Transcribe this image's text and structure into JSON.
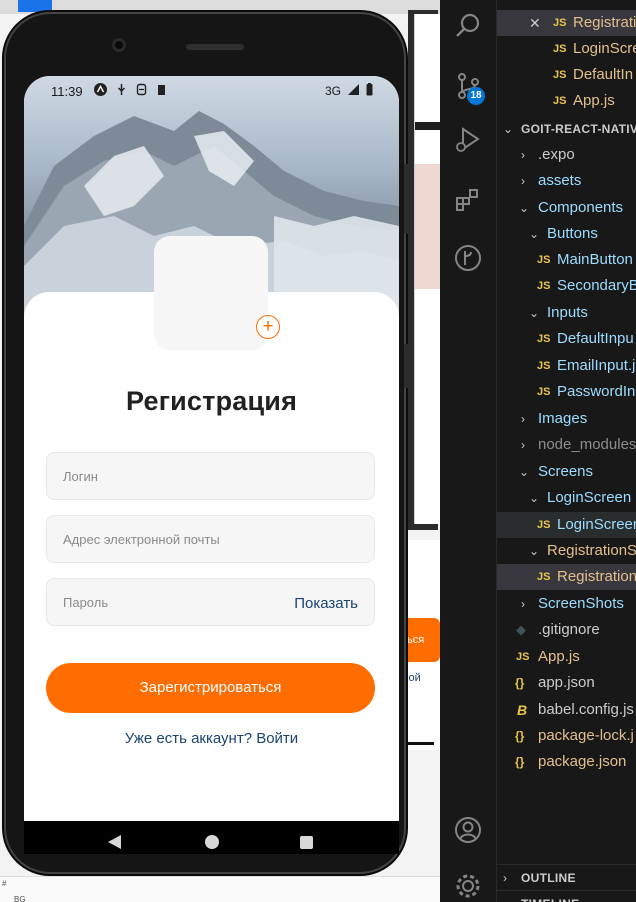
{
  "phone": {
    "status_time": "11:39",
    "status_network": "3G",
    "title": "Регистрация",
    "login_placeholder": "Логин",
    "email_placeholder": "Адрес электронной почты",
    "password_placeholder": "Пароль",
    "show_password_label": "Показать",
    "submit_label": "Зарегистрироваться",
    "login_link": "Уже есть аккаунт? Войти",
    "avatar_add_glyph": "+"
  },
  "background": {
    "button_fragment": "ться",
    "link_fragment": "? Вой",
    "bottom_hash": "#",
    "bottom_item": "BG"
  },
  "vscode": {
    "scm_badge": "18",
    "open_editors": [
      {
        "icon": "JS",
        "name": "Registrati",
        "close": "✕"
      },
      {
        "icon": "JS",
        "name": "LoginScre"
      },
      {
        "icon": "JS",
        "name": "DefaultIn"
      },
      {
        "icon": "JS",
        "name": "App.js"
      }
    ],
    "project_title": "GOIT-REACT-NATIV",
    "tree": [
      {
        "label": ".expo",
        "chev": "›"
      },
      {
        "label": "assets",
        "chev": "›"
      },
      {
        "label": "Components",
        "chev": "⌄"
      },
      {
        "label": "Buttons",
        "chev": "⌄"
      },
      {
        "label": "MainButton",
        "icon": "JS"
      },
      {
        "label": "SecondaryB",
        "icon": "JS"
      },
      {
        "label": "Inputs",
        "chev": "⌄"
      },
      {
        "label": "DefaultInpu",
        "icon": "JS"
      },
      {
        "label": "EmailInput.j",
        "icon": "JS"
      },
      {
        "label": "PasswordInp",
        "icon": "JS"
      },
      {
        "label": "Images",
        "chev": "›"
      },
      {
        "label": "node_modules",
        "chev": "›"
      },
      {
        "label": "Screens",
        "chev": "⌄"
      },
      {
        "label": "LoginScreen",
        "chev": "⌄"
      },
      {
        "label": "LoginScreen",
        "icon": "JS"
      },
      {
        "label": "RegistrationS",
        "chev": "⌄"
      },
      {
        "label": "Registration",
        "icon": "JS"
      },
      {
        "label": "ScreenShots",
        "chev": "›"
      },
      {
        "label": ".gitignore",
        "icon": "◆"
      },
      {
        "label": "App.js",
        "icon": "JS"
      },
      {
        "label": "app.json",
        "icon": "{}"
      },
      {
        "label": "babel.config.js",
        "icon": "B"
      },
      {
        "label": "package-lock.j",
        "icon": "{}"
      },
      {
        "label": "package.json",
        "icon": "{}"
      }
    ],
    "outline_title": "OUTLINE",
    "timeline_title": "TIMELINE"
  },
  "colors": {
    "accent": "#FF6C00",
    "link": "#1B4371",
    "vscode_bg": "#181818",
    "vscode_badge": "#0078D4"
  }
}
